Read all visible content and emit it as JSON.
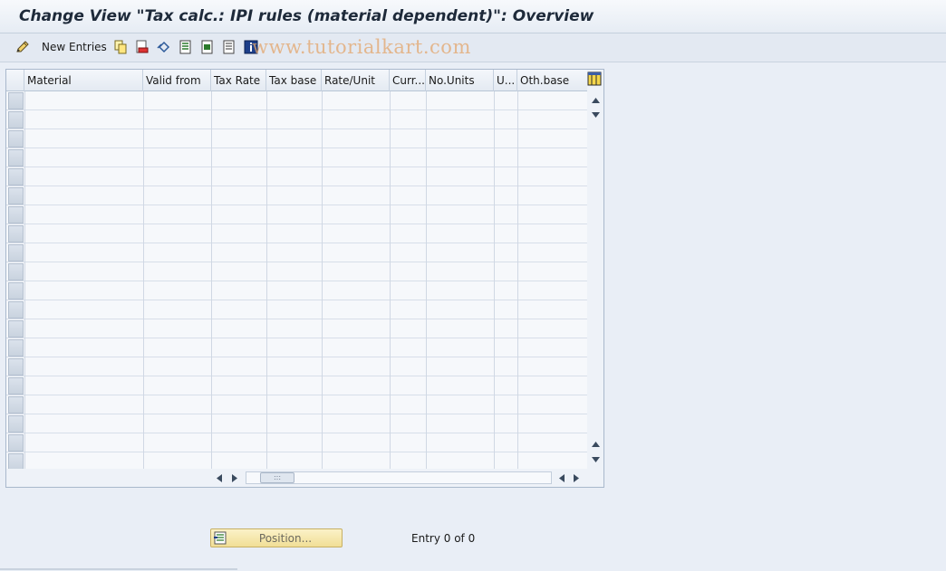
{
  "window": {
    "title": "Change View \"Tax calc.: IPI rules (material dependent)\": Overview"
  },
  "toolbar": {
    "new_entries_label": "New Entries",
    "watermark": "www.tutorialkart.com",
    "icons": [
      "change-pencil-icon",
      "copy-icon",
      "delete-icon",
      "undo-icon",
      "select-all-icon",
      "select-block-icon",
      "deselect-all-icon",
      "info-icon"
    ]
  },
  "table": {
    "columns": [
      "Material",
      "Valid from",
      "Tax Rate",
      "Tax base",
      "Rate/Unit",
      "Curr...",
      "No.Units",
      "U...",
      "Oth.base"
    ],
    "rows": [],
    "visible_empty_rows": 20
  },
  "footer": {
    "position_button_label": "Position...",
    "entry_text": "Entry 0 of 0"
  },
  "colors": {
    "background": "#e9eef6",
    "position_button": "#f5e6a6",
    "watermark": "#e3a66c"
  }
}
